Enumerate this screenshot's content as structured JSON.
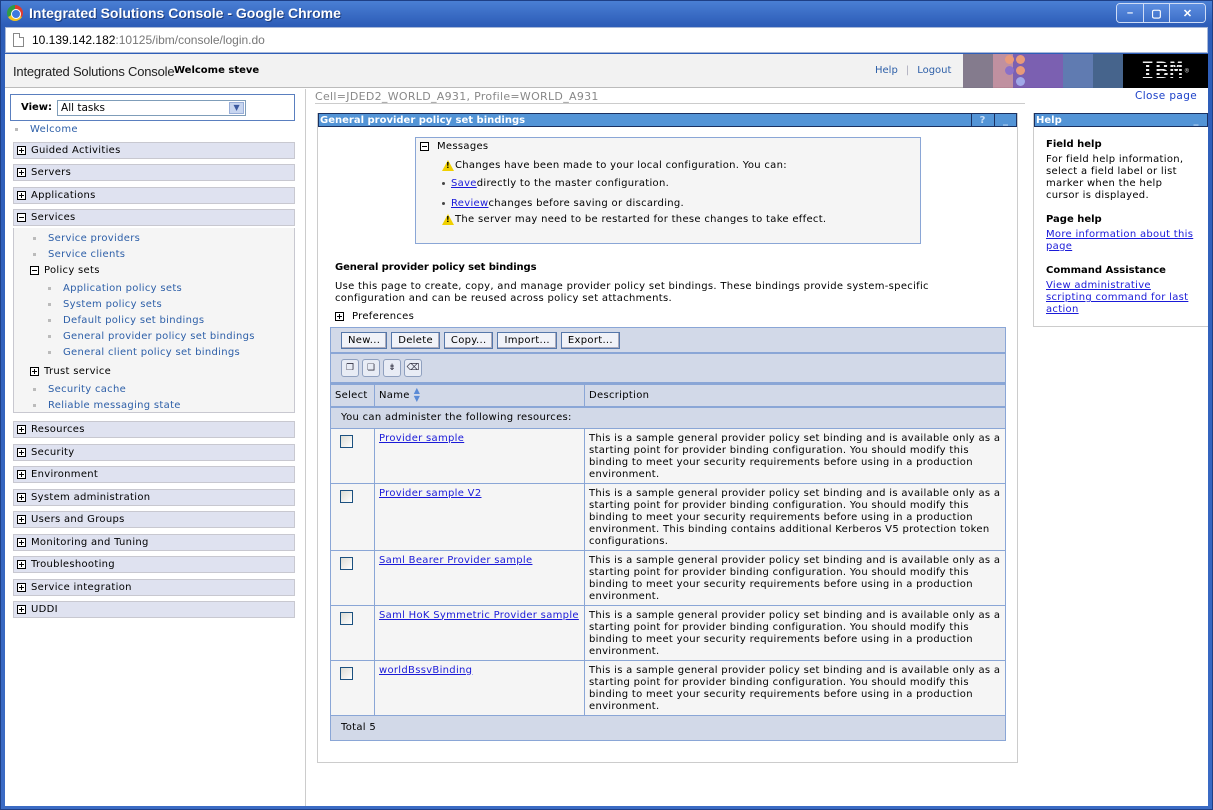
{
  "window": {
    "title": "Integrated Solutions Console - Google Chrome",
    "url_host": "10.139.142.182",
    "url_rest": ":10125/ibm/console/login.do",
    "buttons": {
      "minimize": "–",
      "maximize": "▢",
      "close": "✕"
    }
  },
  "header": {
    "app_title": "Integrated Solutions Console",
    "welcome": "Welcome steve",
    "help_label": "Help",
    "separator": "|",
    "logout_label": "Logout",
    "logo_text": "IBM",
    "logo_mark": "®"
  },
  "nav": {
    "view_label": "View:",
    "view_value": "All tasks",
    "welcome_link": "Welcome",
    "categories_top": [
      {
        "label": "Guided Activities",
        "expanded": false
      },
      {
        "label": "Servers",
        "expanded": false
      },
      {
        "label": "Applications",
        "expanded": false
      },
      {
        "label": "Services",
        "expanded": true
      }
    ],
    "services": {
      "links_top": [
        "Service providers",
        "Service clients"
      ],
      "policy_sets_label": "Policy sets",
      "policy_sets_links": [
        "Application policy sets",
        "System policy sets",
        "Default policy set bindings",
        "General provider policy set bindings",
        "General client policy set bindings"
      ],
      "trust_service_label": "Trust service",
      "links_bottom": [
        "Security cache",
        "Reliable messaging state"
      ]
    },
    "categories_bottom": [
      {
        "label": "Resources"
      },
      {
        "label": "Security"
      },
      {
        "label": "Environment"
      },
      {
        "label": "System administration"
      },
      {
        "label": "Users and Groups"
      },
      {
        "label": "Monitoring and Tuning"
      },
      {
        "label": "Troubleshooting"
      },
      {
        "label": "Service integration"
      },
      {
        "label": "UDDI"
      }
    ]
  },
  "context": {
    "scope": "Cell=JDED2_WORLD_A931, Profile=WORLD_A931",
    "close_page": "Close page"
  },
  "portlet": {
    "title": "General provider policy set bindings",
    "help_btn": "?",
    "min_btn": "_",
    "messages": {
      "title": "Messages",
      "line1": "Changes have been made to your local configuration. You can:",
      "save_link": "Save ",
      "save_rest": "directly to the master configuration.",
      "review_link": "Review",
      "review_rest": " changes before saving or discarding.",
      "line4": "The server may need to be restarted for these changes to take effect."
    },
    "section_title": "General provider policy set bindings",
    "section_desc": "Use this page to create, copy, and manage provider policy set bindings. These bindings provide system-specific configuration and can be reused across policy set attachments.",
    "preferences_label": "Preferences",
    "buttons": [
      "New...",
      "Delete",
      "Copy...",
      "Import...",
      "Export..."
    ],
    "icon_buttons": [
      "select-all-icon",
      "deselect-all-icon",
      "show-filter-icon",
      "clear-filter-icon"
    ],
    "columns": [
      "Select",
      "Name",
      "Description"
    ],
    "info_row": "You can administer the following resources:",
    "rows": [
      {
        "name": "Provider sample",
        "description": "This is a sample general provider policy set binding and is available only as a starting point for provider binding configuration. You should modify this binding to meet your security requirements before using in a production environment."
      },
      {
        "name": "Provider sample V2",
        "description": "This is a sample general provider policy set binding and is available only as a starting point for provider binding configuration. You should modify this binding to meet your security requirements before using in a production environment. This binding contains additional Kerberos V5 protection token configurations."
      },
      {
        "name": "Saml Bearer Provider sample",
        "description": "This is a sample general provider policy set binding and is available only as a starting point for provider binding configuration. You should modify this binding to meet your security requirements before using in a production environment."
      },
      {
        "name": "Saml HoK Symmetric Provider sample",
        "description": "This is a sample general provider policy set binding and is available only as a starting point for provider binding configuration. You should modify this binding to meet your security requirements before using in a production environment."
      },
      {
        "name": "worldBssvBinding",
        "description": "This is a sample general provider policy set binding and is available only as a starting point for provider binding configuration. You should modify this binding to meet your security requirements before using in a production environment."
      }
    ],
    "total": "Total 5"
  },
  "help": {
    "title": "Help",
    "min_btn": "_",
    "field_help_title": "Field help",
    "field_help_text": "For field help information, select a field label or list marker when the help cursor is displayed.",
    "page_help_title": "Page help",
    "page_help_link": "More information about this page",
    "command_title": "Command Assistance",
    "command_link": "View administrative scripting command for last action"
  }
}
